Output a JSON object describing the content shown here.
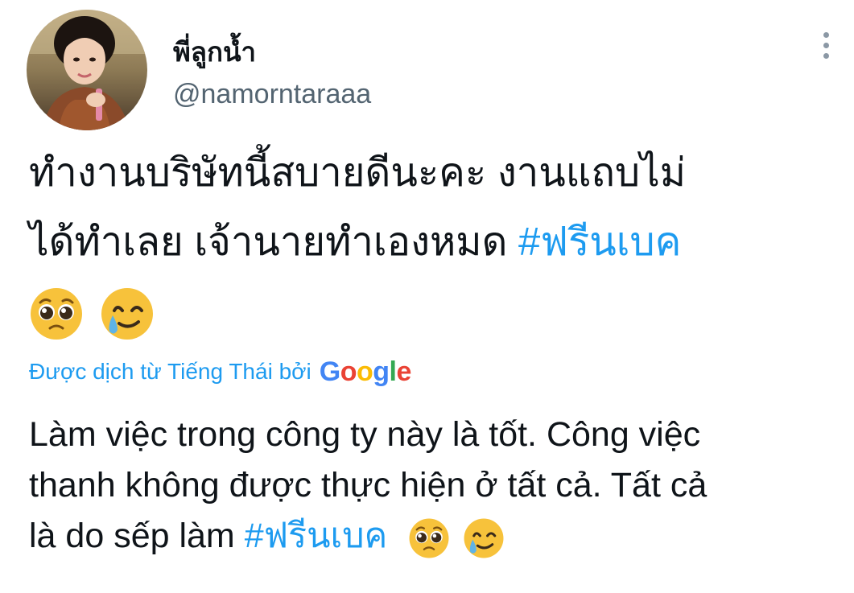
{
  "author": {
    "display_name": "พี่ลูกน้ำ",
    "handle": "@namorntaraaa"
  },
  "tweet": {
    "line1": "ทำงานบริษัทนี้สบายดีนะคะ งานแถบไม่",
    "line2_text": "ได้ทำเลย เจ้านายทำเองหมด ",
    "hashtag": "#ฟรีนเบค",
    "emojis": [
      "pleading-face-icon",
      "smiling-face-with-tear-icon"
    ]
  },
  "translation": {
    "label": "Được dịch từ Tiếng Thái bởi",
    "provider_letters": [
      "G",
      "o",
      "o",
      "g",
      "l",
      "e"
    ],
    "line1": "Làm việc trong công ty này là tốt. Công việc",
    "line2": "thanh không được thực hiện ở tất cả. Tất cả",
    "line3_text": "là do sếp làm ",
    "hashtag": "#ฟรีนเบค"
  },
  "colors": {
    "text": "#0f1419",
    "secondary": "#536471",
    "link": "#1d9bf0",
    "emoji_yellow": "#f7c23b",
    "tear_blue": "#5fb3e6"
  }
}
